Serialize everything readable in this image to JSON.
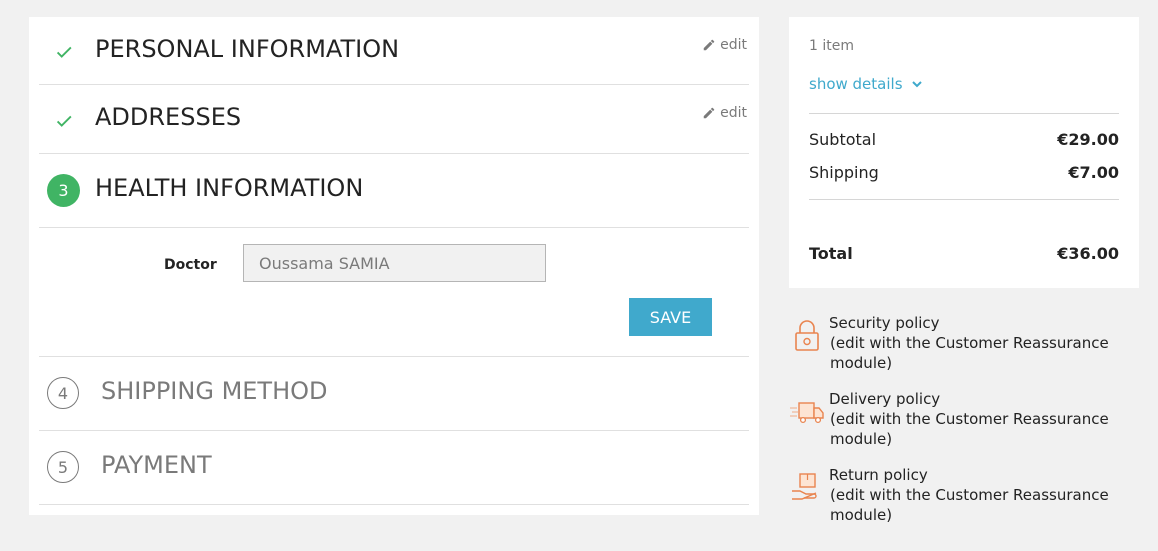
{
  "checkout": {
    "steps": [
      {
        "title": "PERSONAL INFORMATION",
        "edit": "edit",
        "status": "done"
      },
      {
        "title": "ADDRESSES",
        "edit": "edit",
        "status": "done"
      },
      {
        "number": "3",
        "title": "HEALTH INFORMATION",
        "status": "current"
      },
      {
        "number": "4",
        "title": "SHIPPING METHOD",
        "status": "pending"
      },
      {
        "number": "5",
        "title": "PAYMENT",
        "status": "pending"
      }
    ],
    "form": {
      "doctor_label": "Doctor",
      "doctor_value": "Oussama SAMIA",
      "save_label": "SAVE"
    }
  },
  "summary": {
    "items_count": "1 item",
    "show_details": "show details",
    "subtotal_label": "Subtotal",
    "subtotal_value": "€29.00",
    "shipping_label": "Shipping",
    "shipping_value": "€7.00",
    "total_label": "Total",
    "total_value": "€36.00"
  },
  "reassurance": [
    {
      "icon": "padlock-icon",
      "title": "Security policy",
      "desc": "(edit with the Customer Reassurance module)"
    },
    {
      "icon": "delivery-truck-icon",
      "title": "Delivery policy",
      "desc": "(edit with the Customer Reassurance module)"
    },
    {
      "icon": "return-box-icon",
      "title": "Return policy",
      "desc": "(edit with the Customer Reassurance module)"
    }
  ],
  "colors": {
    "accent": "#40a9cc",
    "success": "#40b464",
    "reassurance_icon": "#e9844f"
  }
}
